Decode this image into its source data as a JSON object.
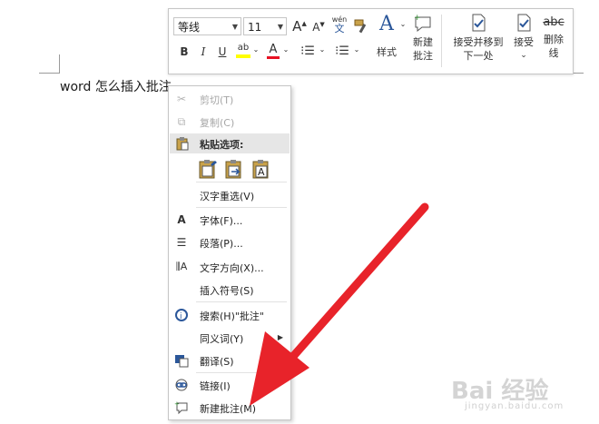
{
  "document": {
    "text": "word 怎么插入批注"
  },
  "toolbar": {
    "font_name": "等线",
    "font_size": "11",
    "grow_font": "A",
    "shrink_font": "A",
    "phonetic_top": "wén",
    "phonetic_bottom": "文",
    "bold": "B",
    "italic": "I",
    "underline": "U",
    "highlight": "ab",
    "font_color": "A",
    "styles_label": "样式",
    "new_comment_label_1": "新建",
    "new_comment_label_2": "批注",
    "accept_move_next_1": "接受并移到",
    "accept_move_next_2": "下一处",
    "accept_label": "接受",
    "delete_label_1": "删除",
    "delete_label_2": "线",
    "strikethrough_sample": "abc"
  },
  "menu": {
    "cut": "剪切(T)",
    "copy": "复制(C)",
    "paste_options": "粘贴选项:",
    "reconvert": "汉字重选(V)",
    "font": "字体(F)...",
    "paragraph": "段落(P)...",
    "text_direction": "文字方向(X)...",
    "insert_symbol": "插入符号(S)",
    "search": "搜索(H)\"批注\"",
    "synonyms": "同义词(Y)",
    "translate": "翻译(S)",
    "link": "链接(I)",
    "new_comment": "新建批注(M)"
  },
  "watermark": {
    "brand": "Bai 经验",
    "url": "jingyan.baidu.com"
  },
  "colors": {
    "arrow": "#e8232a",
    "accent_blue": "#2b579a",
    "highlight_yellow": "#ffff00",
    "font_red": "#e81123"
  }
}
